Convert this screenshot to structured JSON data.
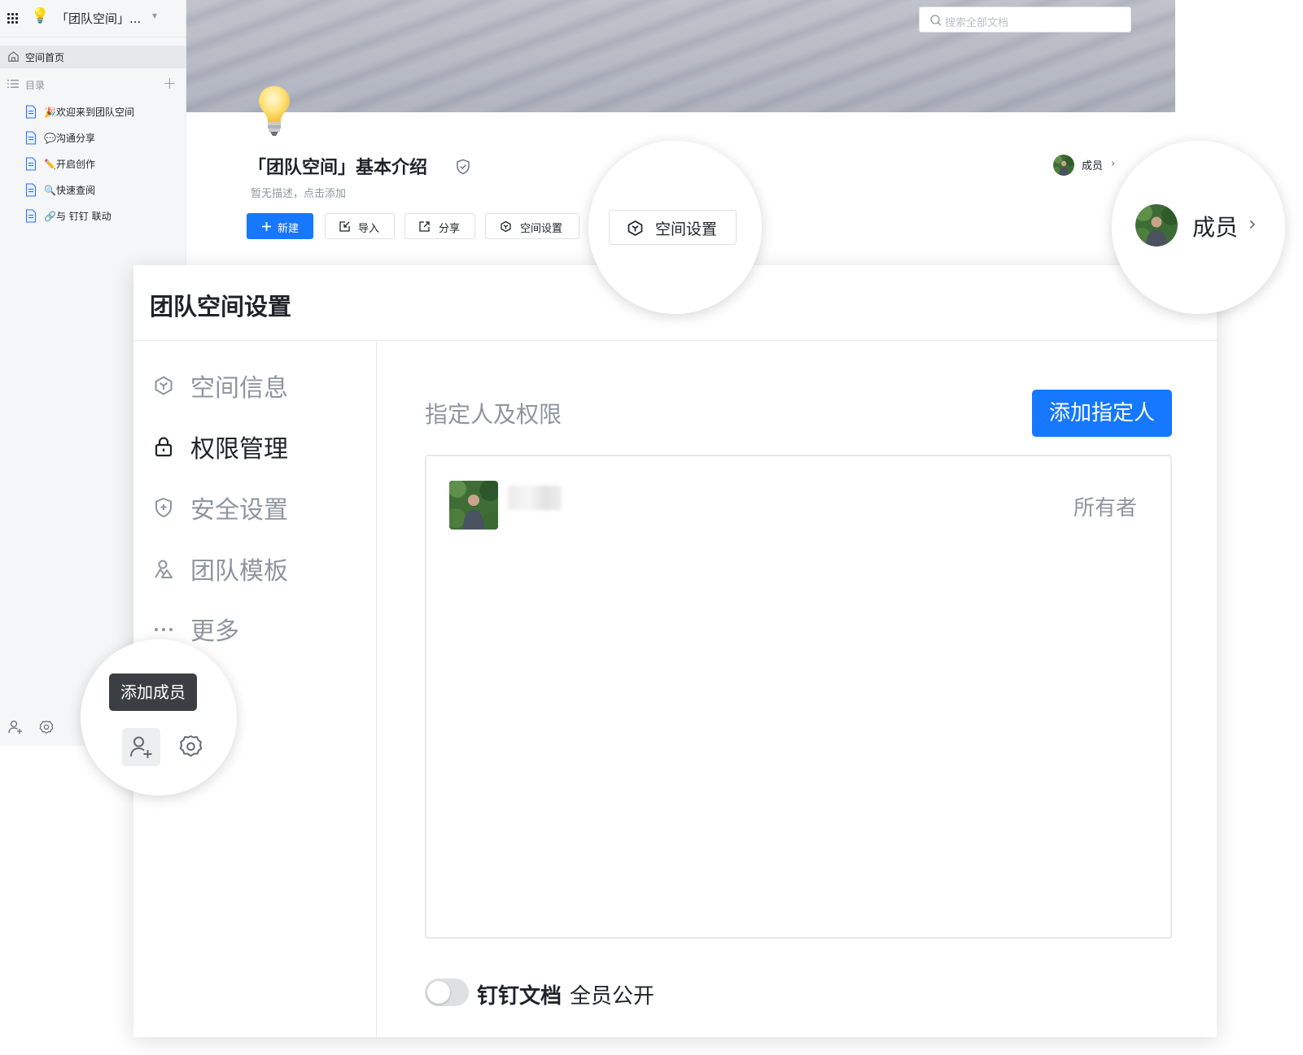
{
  "sidebar": {
    "app_icon": "apps-grid-icon",
    "space_emoji": "💡",
    "space_title": "「团队空间」...",
    "home_label": "空间首页",
    "directory_label": "目录",
    "add_symbol": "+",
    "documents": [
      {
        "label": "🎉欢迎来到团队空间"
      },
      {
        "label": "💬沟通分享"
      },
      {
        "label": "✏️开启创作"
      },
      {
        "label": "🔍快速查阅"
      },
      {
        "label": "🔗与 钉钉 联动"
      }
    ]
  },
  "header": {
    "search_placeholder": "搜索全部文档",
    "space_title": "「团队空间」基本介绍",
    "description": "暂无描述，点击添加",
    "buttons": {
      "new": "新建",
      "import": "导入",
      "share": "分享",
      "settings": "空间设置"
    },
    "members_label": "成员",
    "chevron": "›"
  },
  "modal": {
    "title": "团队空间设置",
    "menu": [
      {
        "label": "空间信息",
        "icon": "space-info-icon",
        "active": false
      },
      {
        "label": "权限管理",
        "icon": "lock-icon",
        "active": true
      },
      {
        "label": "安全设置",
        "icon": "shield-icon",
        "active": false
      },
      {
        "label": "团队模板",
        "icon": "template-icon",
        "active": false
      },
      {
        "label": "更多",
        "icon": "more-icon",
        "active": false
      }
    ],
    "panel_title": "指定人及权限",
    "add_button": "添加指定人",
    "owner_role": "所有者",
    "toggle_enabled": false,
    "toggle_label_bold": "钉钉文档",
    "toggle_label": "全员公开"
  },
  "callouts": {
    "settings_label": "空间设置",
    "members_label": "成员",
    "chevron": "›",
    "tooltip": "添加成员"
  },
  "colors": {
    "primary": "#1677ff",
    "sidebar_bg": "#f5f6f7",
    "text": "#1f2329",
    "muted": "#8f959e",
    "tooltip_bg": "#3b3e43"
  }
}
